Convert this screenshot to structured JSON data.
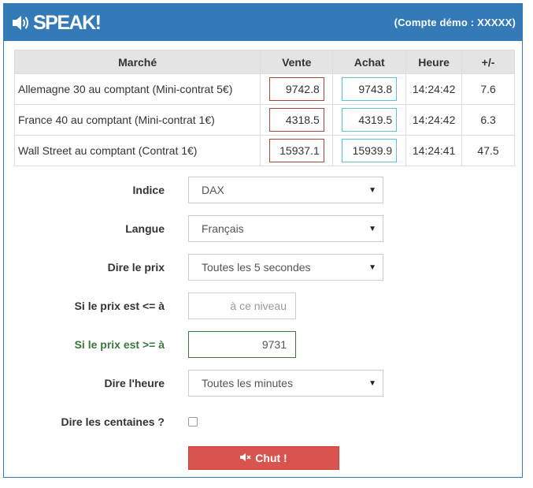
{
  "header": {
    "logo_text": "SPEAK!",
    "account_label": "(Compte démo : XXXXX)",
    "background_color": "#337ab7"
  },
  "quotes_table": {
    "columns": [
      "Marché",
      "Vente",
      "Achat",
      "Heure",
      "+/-"
    ],
    "rows": [
      {
        "market": "Allemagne 30 au comptant (Mini-contrat 5€)",
        "sell": "9742.8",
        "buy": "9743.8",
        "time": "14:24:42",
        "change": "7.6"
      },
      {
        "market": "France 40 au comptant (Mini-contrat 1€)",
        "sell": "4318.5",
        "buy": "4319.5",
        "time": "14:24:42",
        "change": "6.3"
      },
      {
        "market": "Wall Street au comptant (Contrat 1€)",
        "sell": "15937.1",
        "buy": "15939.9",
        "time": "14:24:41",
        "change": "47.5"
      }
    ]
  },
  "form": {
    "index": {
      "label": "Indice",
      "value": "DAX"
    },
    "language": {
      "label": "Langue",
      "value": "Français"
    },
    "say_price": {
      "label": "Dire le prix",
      "value": "Toutes les 5 secondes"
    },
    "price_below": {
      "label": "Si le prix est <= à",
      "value": "",
      "placeholder": "à ce niveau"
    },
    "price_above": {
      "label": "Si le prix est >= à",
      "value": "9731"
    },
    "say_time": {
      "label": "Dire l'heure",
      "value": "Toutes les minutes"
    },
    "say_hundreds": {
      "label": "Dire les centaines ?",
      "checked": false
    }
  },
  "stop_button": {
    "label": "Chut !",
    "icon": "volume-off-icon",
    "color": "#d9534f"
  },
  "colors": {
    "sell_border": "#a94442",
    "buy_border": "#5bc0de",
    "success_text": "#3c763d"
  }
}
